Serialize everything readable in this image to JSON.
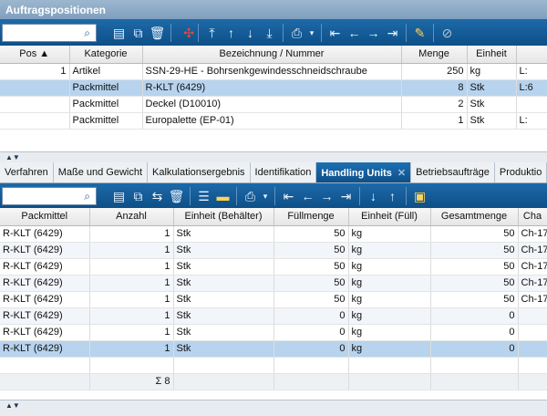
{
  "window": {
    "title": "Auftragspositionen"
  },
  "icons": {
    "top": [
      "new-document-icon",
      "document-2-icon",
      "delete-icon",
      "move-icon",
      "move-top-icon",
      "move-up-icon",
      "move-down-icon",
      "move-bottom-icon",
      "print-icon",
      "dropdown-icon",
      "first-icon",
      "previous-icon",
      "next-icon",
      "last-icon",
      "edit-pencil-icon",
      "cancel-icon"
    ],
    "bottom": [
      "new-document-icon",
      "document-copy-icon",
      "swap-icon",
      "delete-icon",
      "list-icon",
      "card-icon",
      "print-icon",
      "dropdown-icon",
      "first-icon",
      "previous-icon",
      "next-icon",
      "last-icon",
      "move-down-icon",
      "move-up-icon",
      "package-icon"
    ]
  },
  "positions": {
    "columns": [
      "Pos ▲",
      "Kategorie",
      "Bezeichnung / Nummer",
      "Menge",
      "Einheit",
      ""
    ],
    "rows": [
      {
        "pos": "1",
        "kategorie": "Artikel",
        "bezeichnung": "SSN-29-HE - Bohrsenkgewindesschneidschraube",
        "menge": "250",
        "einheit": "kg",
        "extra": "L:"
      },
      {
        "pos": "",
        "kategorie": "Packmittel",
        "bezeichnung": "R-KLT (6429)",
        "menge": "8",
        "einheit": "Stk",
        "extra": "L:6"
      },
      {
        "pos": "",
        "kategorie": "Packmittel",
        "bezeichnung": "Deckel (D10010)",
        "menge": "2",
        "einheit": "Stk",
        "extra": ""
      },
      {
        "pos": "",
        "kategorie": "Packmittel",
        "bezeichnung": "Europalette (EP-01)",
        "menge": "1",
        "einheit": "Stk",
        "extra": "L:"
      }
    ]
  },
  "tabs": [
    {
      "label": "Verfahren"
    },
    {
      "label": "Maße und Gewicht"
    },
    {
      "label": "Kalkulationsergebnis"
    },
    {
      "label": "Identifikation"
    },
    {
      "label": "Handling Units",
      "active": true
    },
    {
      "label": "Betriebsaufträge"
    },
    {
      "label": "Produktio"
    }
  ],
  "handling_units": {
    "columns": [
      "Packmittel",
      "Anzahl",
      "Einheit (Behälter)",
      "Füllmenge",
      "Einheit (Füll)",
      "Gesamtmenge",
      "Cha"
    ],
    "rows": [
      {
        "packmittel": "R-KLT (6429)",
        "anzahl": "1",
        "einheit": "Stk",
        "fuell": "50",
        "einheit_fuell": "kg",
        "gesamt": "50",
        "charge": "Ch-17"
      },
      {
        "packmittel": "R-KLT (6429)",
        "anzahl": "1",
        "einheit": "Stk",
        "fuell": "50",
        "einheit_fuell": "kg",
        "gesamt": "50",
        "charge": "Ch-17"
      },
      {
        "packmittel": "R-KLT (6429)",
        "anzahl": "1",
        "einheit": "Stk",
        "fuell": "50",
        "einheit_fuell": "kg",
        "gesamt": "50",
        "charge": "Ch-17"
      },
      {
        "packmittel": "R-KLT (6429)",
        "anzahl": "1",
        "einheit": "Stk",
        "fuell": "50",
        "einheit_fuell": "kg",
        "gesamt": "50",
        "charge": "Ch-17"
      },
      {
        "packmittel": "R-KLT (6429)",
        "anzahl": "1",
        "einheit": "Stk",
        "fuell": "50",
        "einheit_fuell": "kg",
        "gesamt": "50",
        "charge": "Ch-17"
      },
      {
        "packmittel": "R-KLT (6429)",
        "anzahl": "1",
        "einheit": "Stk",
        "fuell": "0",
        "einheit_fuell": "kg",
        "gesamt": "0",
        "charge": ""
      },
      {
        "packmittel": "R-KLT (6429)",
        "anzahl": "1",
        "einheit": "Stk",
        "fuell": "0",
        "einheit_fuell": "kg",
        "gesamt": "0",
        "charge": ""
      },
      {
        "packmittel": "R-KLT (6429)",
        "anzahl": "1",
        "einheit": "Stk",
        "fuell": "0",
        "einheit_fuell": "kg",
        "gesamt": "0",
        "charge": ""
      }
    ],
    "sum": "Σ 8"
  },
  "splitter": {
    "glyph": "▲▼"
  }
}
